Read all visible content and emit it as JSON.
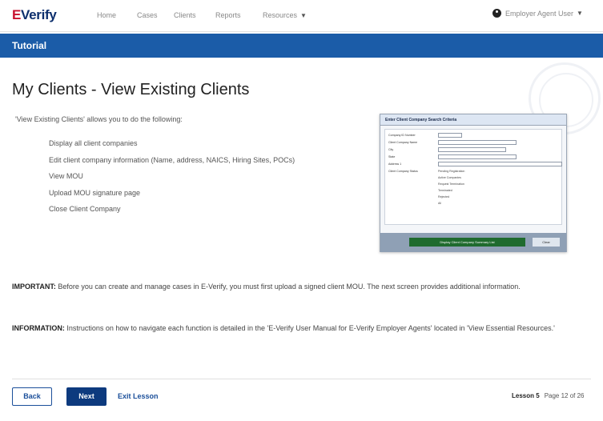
{
  "nav": {
    "logo_e": "E",
    "logo_verify": "Verify",
    "links": [
      "Home",
      "Cases",
      "Clients",
      "Reports",
      "Resources"
    ],
    "user": "Employer Agent User"
  },
  "tutorial_bar": "Tutorial",
  "page_title": "My Clients - View Existing Clients",
  "intro": "'View Existing Clients' allows you to do the following:",
  "bullets": [
    "Display all client companies",
    "Edit client company information (Name, address, NAICS, Hiring Sites, POCs)",
    "View MOU",
    "Upload MOU signature page",
    "Close Client Company"
  ],
  "screenshot": {
    "header": "Enter Client Company Search Criteria",
    "fields": [
      "Company ID Number",
      "Client Company Name",
      "City",
      "State",
      "Address 1",
      "Client Company Status"
    ],
    "statuses": [
      "Pending Registration",
      "Active Companies",
      "Request Termination",
      "Terminated",
      "Rejected",
      "All"
    ],
    "primary_button": "Display Client Company Summary List",
    "secondary_button": "Clear"
  },
  "important": {
    "label": "IMPORTANT:",
    "text": " Before you can create and manage cases in E-Verify, you must first upload a signed client MOU. The next screen provides additional information."
  },
  "information": {
    "label": "INFORMATION:",
    "text": " Instructions on how to navigate each function is detailed in the 'E-Verify User Manual for E-Verify Employer Agents' located in 'View Essential Resources.'"
  },
  "footer": {
    "back": "Back",
    "next": "Next",
    "exit": "Exit Lesson",
    "lesson": "Lesson 5",
    "page": "Page 12 of 26"
  }
}
